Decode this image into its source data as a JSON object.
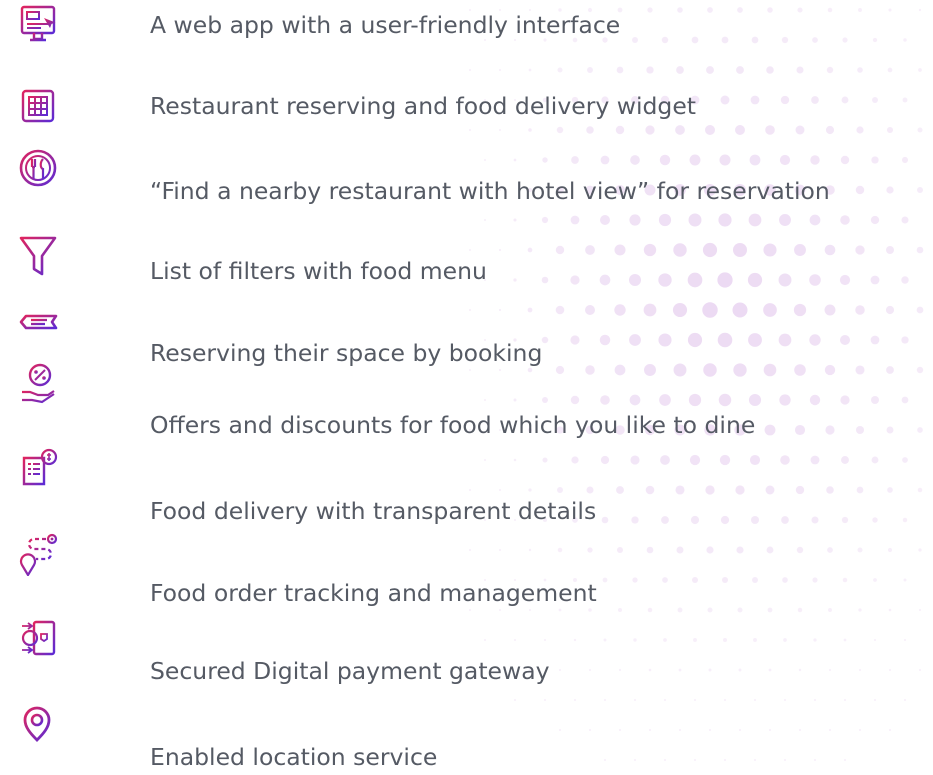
{
  "theme": {
    "text_color": "#555a64",
    "icon_gradient_start": "#e0245e",
    "icon_gradient_end": "#5b2bd6",
    "dot_color": "#e8d2f0"
  },
  "features": [
    {
      "icon": "web-app-monitor-icon",
      "label": "A web app with a user-friendly interface"
    },
    {
      "icon": "widget-grid-icon",
      "label": "Restaurant reserving and food delivery widget"
    },
    {
      "icon": "restaurant-cutlery-icon",
      "label": "“Find a nearby restaurant with hotel view” for reservation"
    },
    {
      "icon": "filter-funnel-icon",
      "label": "List of filters with food menu"
    },
    {
      "icon": "booking-ticket-icon",
      "label": "Reserving their space by booking"
    },
    {
      "icon": "discount-hand-icon",
      "label": "Offers and discounts for food which you like to dine"
    },
    {
      "icon": "delivery-receipt-icon",
      "label": "Food delivery with transparent details"
    },
    {
      "icon": "route-tracking-icon",
      "label": "Food order tracking and management"
    },
    {
      "icon": "secure-payment-icon",
      "label": "Secured Digital payment gateway"
    },
    {
      "icon": "location-pin-icon",
      "label": "Enabled location service"
    }
  ]
}
